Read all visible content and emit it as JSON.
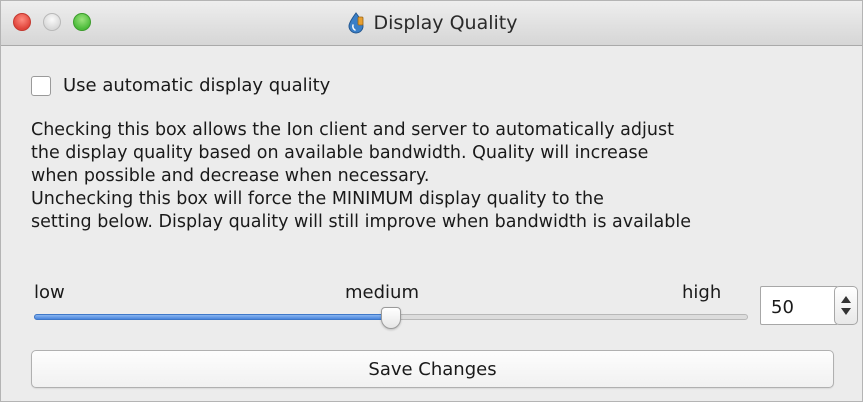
{
  "window": {
    "title": "Display Quality",
    "title_icon": "ion-drop-icon"
  },
  "auto_quality": {
    "label": "Use automatic display quality",
    "checked": false
  },
  "description": {
    "lines": [
      "Checking this box allows the Ion client and server to automatically adjust",
      "the display quality based on available bandwidth.  Quality will increase",
      "when possible and decrease when necessary.",
      "Unchecking this box will force the MINIMUM display quality to the",
      "setting below.  Display quality will still improve when bandwidth is available"
    ]
  },
  "quality_slider": {
    "label_low": "low",
    "label_medium": "medium",
    "label_high": "high",
    "value": 50,
    "min": 0,
    "max": 100
  },
  "quality_stepper": {
    "value": "50"
  },
  "save_button": {
    "label": "Save Changes"
  },
  "colors": {
    "slider_fill": "#4a86de",
    "close_button": "#e0443a",
    "zoom_button": "#4cbc3a"
  }
}
